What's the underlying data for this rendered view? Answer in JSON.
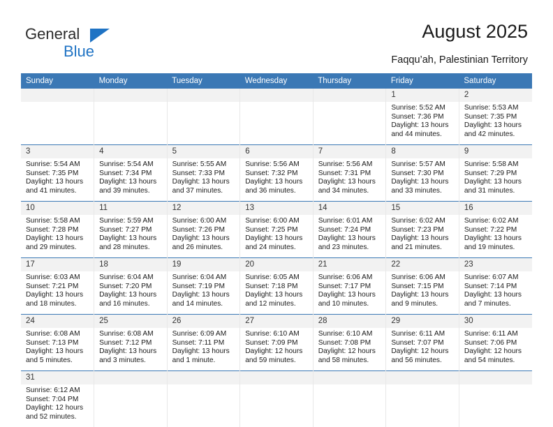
{
  "logo": {
    "word1": "General",
    "word2": "Blue",
    "triangle_color": "#1f73c4"
  },
  "header": {
    "title": "August 2025",
    "subtitle": "Faqqu’ah, Palestinian Territory",
    "header_bg": "#3b78b5"
  },
  "weekdays": [
    "Sunday",
    "Monday",
    "Tuesday",
    "Wednesday",
    "Thursday",
    "Friday",
    "Saturday"
  ],
  "labels": {
    "sunrise_prefix": "Sunrise:",
    "sunset_prefix": "Sunset:",
    "daylight_prefix": "Daylight:"
  },
  "weeks": [
    [
      {
        "day": "",
        "blank": true
      },
      {
        "day": "",
        "blank": true
      },
      {
        "day": "",
        "blank": true
      },
      {
        "day": "",
        "blank": true
      },
      {
        "day": "",
        "blank": true
      },
      {
        "day": "1",
        "sunrise": "Sunrise: 5:52 AM",
        "sunset": "Sunset: 7:36 PM",
        "daylight1": "Daylight: 13 hours",
        "daylight2": "and 44 minutes."
      },
      {
        "day": "2",
        "sunrise": "Sunrise: 5:53 AM",
        "sunset": "Sunset: 7:35 PM",
        "daylight1": "Daylight: 13 hours",
        "daylight2": "and 42 minutes."
      }
    ],
    [
      {
        "day": "3",
        "sunrise": "Sunrise: 5:54 AM",
        "sunset": "Sunset: 7:35 PM",
        "daylight1": "Daylight: 13 hours",
        "daylight2": "and 41 minutes."
      },
      {
        "day": "4",
        "sunrise": "Sunrise: 5:54 AM",
        "sunset": "Sunset: 7:34 PM",
        "daylight1": "Daylight: 13 hours",
        "daylight2": "and 39 minutes."
      },
      {
        "day": "5",
        "sunrise": "Sunrise: 5:55 AM",
        "sunset": "Sunset: 7:33 PM",
        "daylight1": "Daylight: 13 hours",
        "daylight2": "and 37 minutes."
      },
      {
        "day": "6",
        "sunrise": "Sunrise: 5:56 AM",
        "sunset": "Sunset: 7:32 PM",
        "daylight1": "Daylight: 13 hours",
        "daylight2": "and 36 minutes."
      },
      {
        "day": "7",
        "sunrise": "Sunrise: 5:56 AM",
        "sunset": "Sunset: 7:31 PM",
        "daylight1": "Daylight: 13 hours",
        "daylight2": "and 34 minutes."
      },
      {
        "day": "8",
        "sunrise": "Sunrise: 5:57 AM",
        "sunset": "Sunset: 7:30 PM",
        "daylight1": "Daylight: 13 hours",
        "daylight2": "and 33 minutes."
      },
      {
        "day": "9",
        "sunrise": "Sunrise: 5:58 AM",
        "sunset": "Sunset: 7:29 PM",
        "daylight1": "Daylight: 13 hours",
        "daylight2": "and 31 minutes."
      }
    ],
    [
      {
        "day": "10",
        "sunrise": "Sunrise: 5:58 AM",
        "sunset": "Sunset: 7:28 PM",
        "daylight1": "Daylight: 13 hours",
        "daylight2": "and 29 minutes."
      },
      {
        "day": "11",
        "sunrise": "Sunrise: 5:59 AM",
        "sunset": "Sunset: 7:27 PM",
        "daylight1": "Daylight: 13 hours",
        "daylight2": "and 28 minutes."
      },
      {
        "day": "12",
        "sunrise": "Sunrise: 6:00 AM",
        "sunset": "Sunset: 7:26 PM",
        "daylight1": "Daylight: 13 hours",
        "daylight2": "and 26 minutes."
      },
      {
        "day": "13",
        "sunrise": "Sunrise: 6:00 AM",
        "sunset": "Sunset: 7:25 PM",
        "daylight1": "Daylight: 13 hours",
        "daylight2": "and 24 minutes."
      },
      {
        "day": "14",
        "sunrise": "Sunrise: 6:01 AM",
        "sunset": "Sunset: 7:24 PM",
        "daylight1": "Daylight: 13 hours",
        "daylight2": "and 23 minutes."
      },
      {
        "day": "15",
        "sunrise": "Sunrise: 6:02 AM",
        "sunset": "Sunset: 7:23 PM",
        "daylight1": "Daylight: 13 hours",
        "daylight2": "and 21 minutes."
      },
      {
        "day": "16",
        "sunrise": "Sunrise: 6:02 AM",
        "sunset": "Sunset: 7:22 PM",
        "daylight1": "Daylight: 13 hours",
        "daylight2": "and 19 minutes."
      }
    ],
    [
      {
        "day": "17",
        "sunrise": "Sunrise: 6:03 AM",
        "sunset": "Sunset: 7:21 PM",
        "daylight1": "Daylight: 13 hours",
        "daylight2": "and 18 minutes."
      },
      {
        "day": "18",
        "sunrise": "Sunrise: 6:04 AM",
        "sunset": "Sunset: 7:20 PM",
        "daylight1": "Daylight: 13 hours",
        "daylight2": "and 16 minutes."
      },
      {
        "day": "19",
        "sunrise": "Sunrise: 6:04 AM",
        "sunset": "Sunset: 7:19 PM",
        "daylight1": "Daylight: 13 hours",
        "daylight2": "and 14 minutes."
      },
      {
        "day": "20",
        "sunrise": "Sunrise: 6:05 AM",
        "sunset": "Sunset: 7:18 PM",
        "daylight1": "Daylight: 13 hours",
        "daylight2": "and 12 minutes."
      },
      {
        "day": "21",
        "sunrise": "Sunrise: 6:06 AM",
        "sunset": "Sunset: 7:17 PM",
        "daylight1": "Daylight: 13 hours",
        "daylight2": "and 10 minutes."
      },
      {
        "day": "22",
        "sunrise": "Sunrise: 6:06 AM",
        "sunset": "Sunset: 7:15 PM",
        "daylight1": "Daylight: 13 hours",
        "daylight2": "and 9 minutes."
      },
      {
        "day": "23",
        "sunrise": "Sunrise: 6:07 AM",
        "sunset": "Sunset: 7:14 PM",
        "daylight1": "Daylight: 13 hours",
        "daylight2": "and 7 minutes."
      }
    ],
    [
      {
        "day": "24",
        "sunrise": "Sunrise: 6:08 AM",
        "sunset": "Sunset: 7:13 PM",
        "daylight1": "Daylight: 13 hours",
        "daylight2": "and 5 minutes."
      },
      {
        "day": "25",
        "sunrise": "Sunrise: 6:08 AM",
        "sunset": "Sunset: 7:12 PM",
        "daylight1": "Daylight: 13 hours",
        "daylight2": "and 3 minutes."
      },
      {
        "day": "26",
        "sunrise": "Sunrise: 6:09 AM",
        "sunset": "Sunset: 7:11 PM",
        "daylight1": "Daylight: 13 hours",
        "daylight2": "and 1 minute."
      },
      {
        "day": "27",
        "sunrise": "Sunrise: 6:10 AM",
        "sunset": "Sunset: 7:09 PM",
        "daylight1": "Daylight: 12 hours",
        "daylight2": "and 59 minutes."
      },
      {
        "day": "28",
        "sunrise": "Sunrise: 6:10 AM",
        "sunset": "Sunset: 7:08 PM",
        "daylight1": "Daylight: 12 hours",
        "daylight2": "and 58 minutes."
      },
      {
        "day": "29",
        "sunrise": "Sunrise: 6:11 AM",
        "sunset": "Sunset: 7:07 PM",
        "daylight1": "Daylight: 12 hours",
        "daylight2": "and 56 minutes."
      },
      {
        "day": "30",
        "sunrise": "Sunrise: 6:11 AM",
        "sunset": "Sunset: 7:06 PM",
        "daylight1": "Daylight: 12 hours",
        "daylight2": "and 54 minutes."
      }
    ],
    [
      {
        "day": "31",
        "sunrise": "Sunrise: 6:12 AM",
        "sunset": "Sunset: 7:04 PM",
        "daylight1": "Daylight: 12 hours",
        "daylight2": "and 52 minutes."
      },
      {
        "day": "",
        "blank": true
      },
      {
        "day": "",
        "blank": true
      },
      {
        "day": "",
        "blank": true
      },
      {
        "day": "",
        "blank": true
      },
      {
        "day": "",
        "blank": true
      },
      {
        "day": "",
        "blank": true
      }
    ]
  ]
}
